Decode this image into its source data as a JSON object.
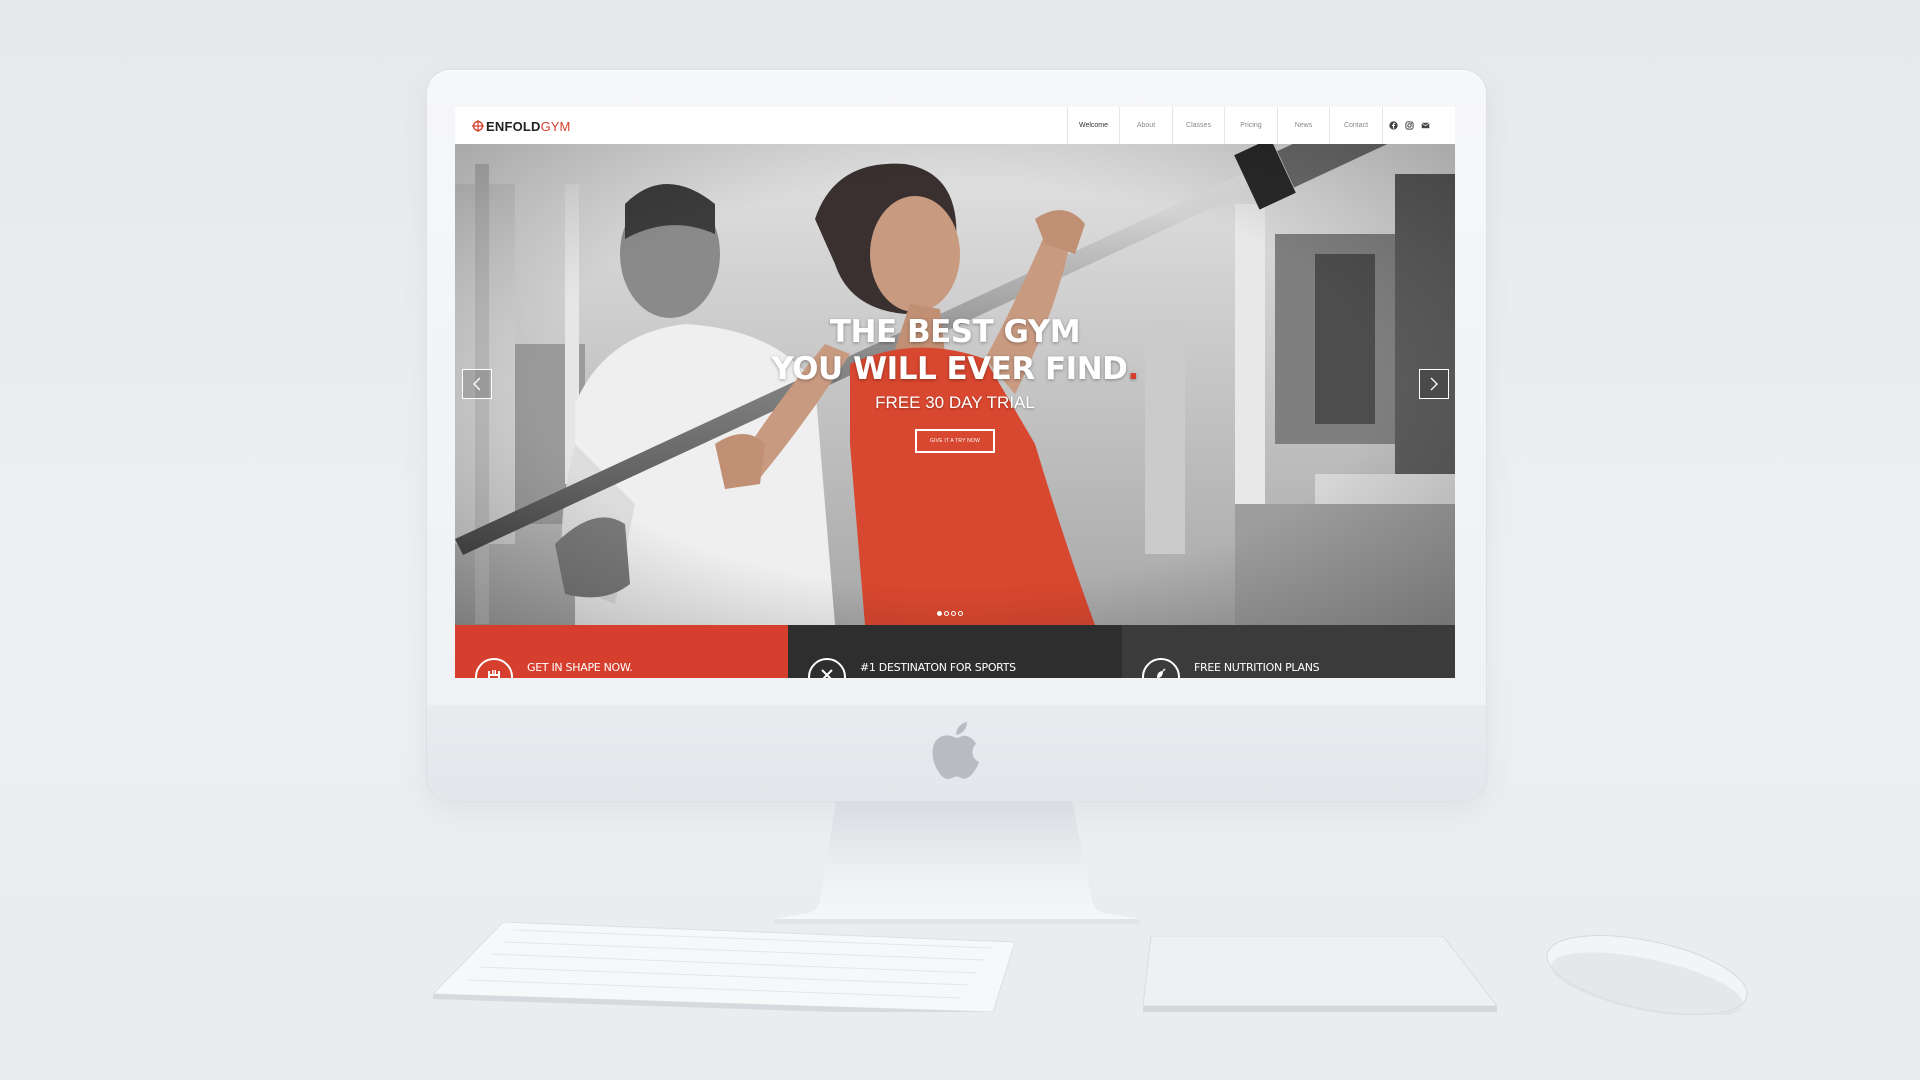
{
  "site": {
    "logo_primary": "ENFOLD",
    "logo_secondary": "GYM",
    "brand_color": "#d63f2d"
  },
  "nav": {
    "items": [
      {
        "label": "Welcome",
        "active": true
      },
      {
        "label": "About",
        "active": false
      },
      {
        "label": "Classes",
        "active": false
      },
      {
        "label": "Pricing",
        "active": false
      },
      {
        "label": "News",
        "active": false
      },
      {
        "label": "Contact",
        "active": false
      }
    ],
    "social_icons": [
      "facebook-icon",
      "instagram-icon",
      "mail-icon"
    ]
  },
  "hero": {
    "headline_line1": "THE BEST GYM",
    "headline_line2": "YOU WILL EVER FIND",
    "headline_dot": ".",
    "subline": "FREE 30 DAY TRIAL",
    "cta_label": "GIVE IT A TRY NOW",
    "slide_count": 4,
    "active_slide": 1
  },
  "features": [
    {
      "title": "GET IN SHAPE NOW.",
      "color": "#d63f2d",
      "icon": "dumbbell-icon"
    },
    {
      "title": "#1 DESTINATON FOR SPORTS",
      "color": "#2e2e2e",
      "icon": "tools-icon"
    },
    {
      "title": "FREE NUTRITION PLANS",
      "color": "#3b3b3b",
      "icon": "nutrition-icon"
    }
  ]
}
